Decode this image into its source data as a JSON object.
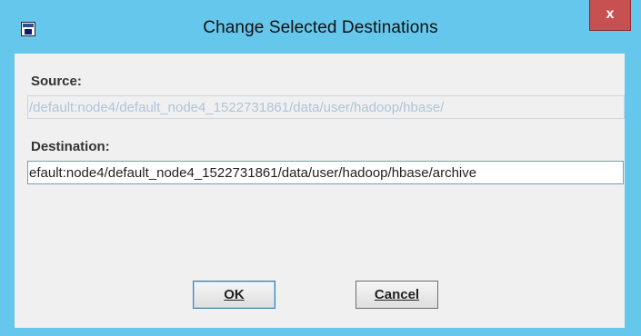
{
  "window": {
    "title": "Change Selected Destinations",
    "close_glyph": "x",
    "app_icon": "java-app-icon",
    "accent_color": "#66c7ec",
    "close_color": "#c75050"
  },
  "form": {
    "source_label": "Source:",
    "source_value": "/default:node4/default_node4_1522731861/data/user/hadoop/hbase/",
    "destination_label": "Destination:",
    "destination_value": "efault:node4/default_node4_1522731861/data/user/hadoop/hbase/archive"
  },
  "buttons": {
    "ok_label": "OK",
    "cancel_label": "Cancel"
  }
}
